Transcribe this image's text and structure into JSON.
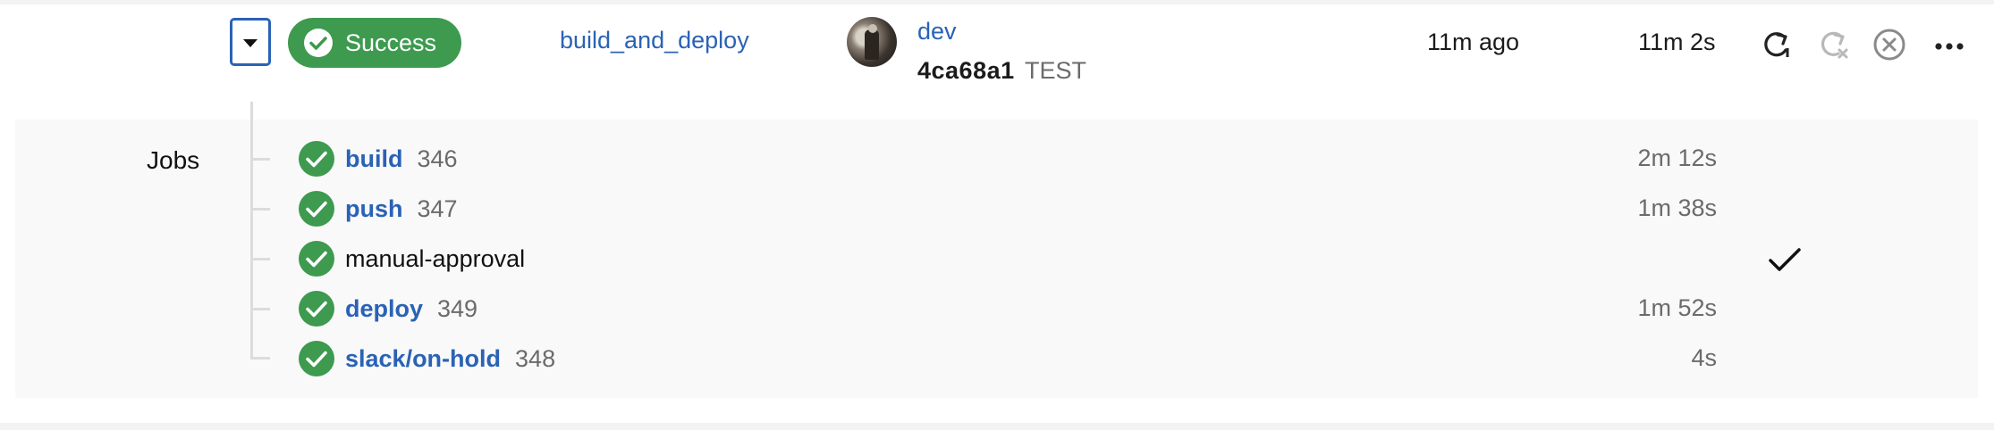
{
  "pipeline": {
    "status": "Success",
    "workflow": "build_and_deploy",
    "branch": "dev",
    "commit_hash": "4ca68a1",
    "commit_message": "TEST",
    "started": "11m ago",
    "duration": "11m 2s"
  },
  "actions": [
    "rerun-icon",
    "rerun-failed-icon",
    "cancel-icon",
    "more-icon"
  ],
  "jobs_label": "Jobs",
  "jobs": [
    {
      "name": "build",
      "number": "346",
      "duration": "2m 12s",
      "linked": true
    },
    {
      "name": "push",
      "number": "347",
      "duration": "1m 38s",
      "linked": true
    },
    {
      "name": "manual-approval",
      "number": "",
      "duration": "",
      "linked": false,
      "approved": true
    },
    {
      "name": "deploy",
      "number": "349",
      "duration": "1m 52s",
      "linked": true
    },
    {
      "name": "slack/on-hold",
      "number": "348",
      "duration": "4s",
      "linked": true
    }
  ],
  "colors": {
    "success": "#3d9a4f",
    "link": "#2a62b5",
    "muted": "#6b6b6b",
    "panel": "#f9f9f9"
  }
}
